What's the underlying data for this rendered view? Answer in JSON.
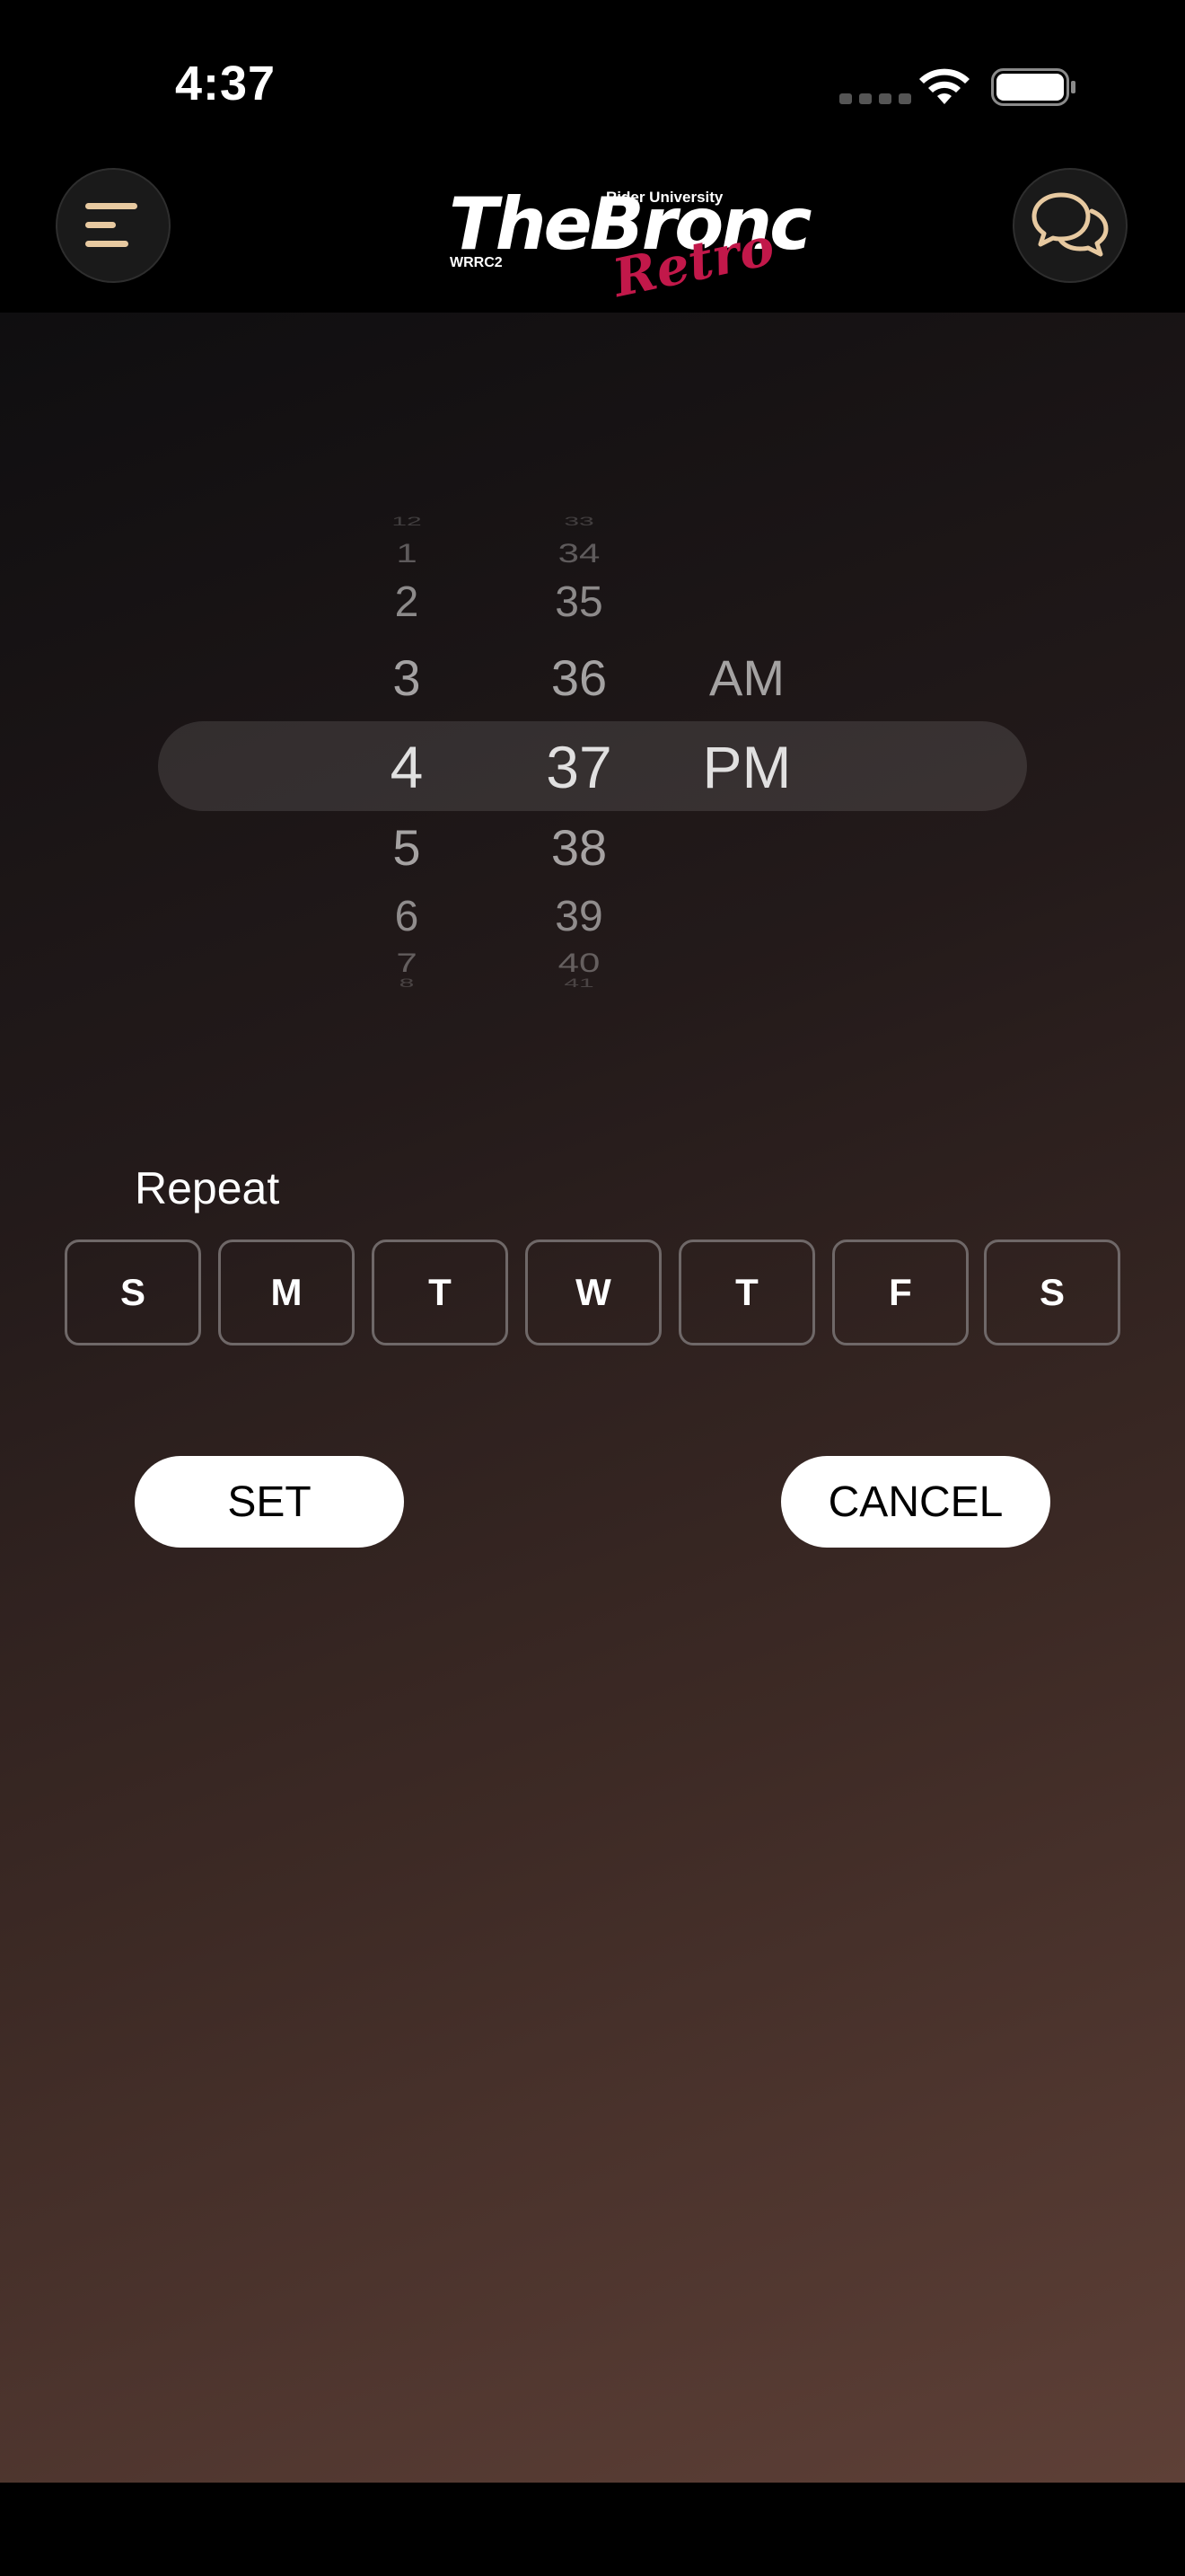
{
  "status_bar": {
    "time": "4:37"
  },
  "header": {
    "logo": {
      "top": "Rider University",
      "main": "TheBronc",
      "sub": "WRRC2",
      "script": "Retro"
    }
  },
  "picker": {
    "hours": [
      "12",
      "1",
      "2",
      "3",
      "4",
      "5",
      "6",
      "7",
      "8"
    ],
    "minutes": [
      "33",
      "34",
      "35",
      "36",
      "37",
      "38",
      "39",
      "40",
      "41"
    ],
    "ampm": [
      "AM",
      "PM"
    ],
    "selected": {
      "hour": "4",
      "minute": "37",
      "period": "PM"
    }
  },
  "repeat": {
    "label": "Repeat",
    "days": [
      "S",
      "M",
      "T",
      "W",
      "T",
      "F",
      "S"
    ]
  },
  "actions": {
    "set_label": "SET",
    "cancel_label": "CANCEL"
  },
  "icons": {
    "menu": "menu-icon",
    "chat": "chat-bubbles-icon",
    "wifi": "wifi-icon",
    "battery": "battery-icon"
  },
  "colors": {
    "accent_icon": "#e7c9a0",
    "logo_script": "#c2184a",
    "button_bg": "#ffffff"
  }
}
